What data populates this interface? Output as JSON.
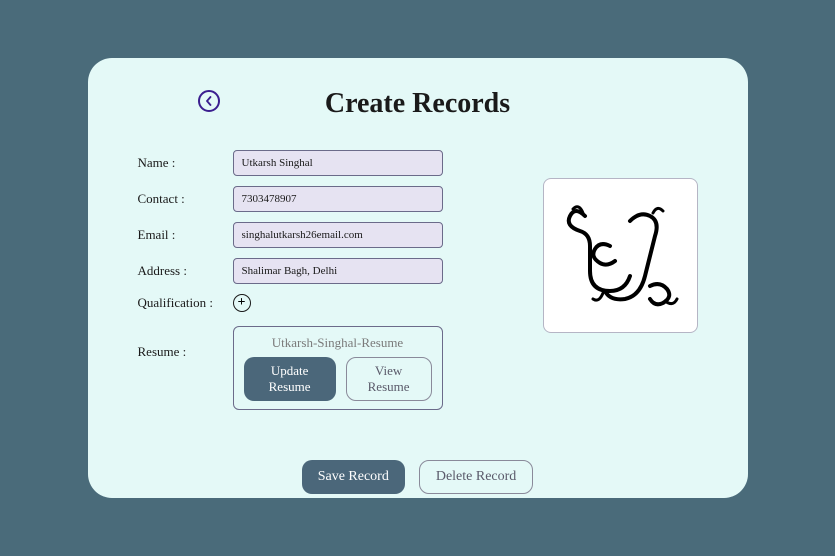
{
  "title": "Create Records",
  "form": {
    "name_label": "Name :",
    "name_value": "Utkarsh Singhal",
    "contact_label": "Contact :",
    "contact_value": "7303478907",
    "email_label": "Email :",
    "email_value": "singhalutkarsh26email.com",
    "address_label": "Address :",
    "address_value": "Shalimar Bagh, Delhi",
    "qualification_label": "Qualification :",
    "resume_label": "Resume :",
    "resume_filename": "Utkarsh-Singhal-Resume",
    "update_resume": "Update Resume",
    "view_resume": "View Resume"
  },
  "actions": {
    "save": "Save Record",
    "delete": "Delete Record"
  }
}
